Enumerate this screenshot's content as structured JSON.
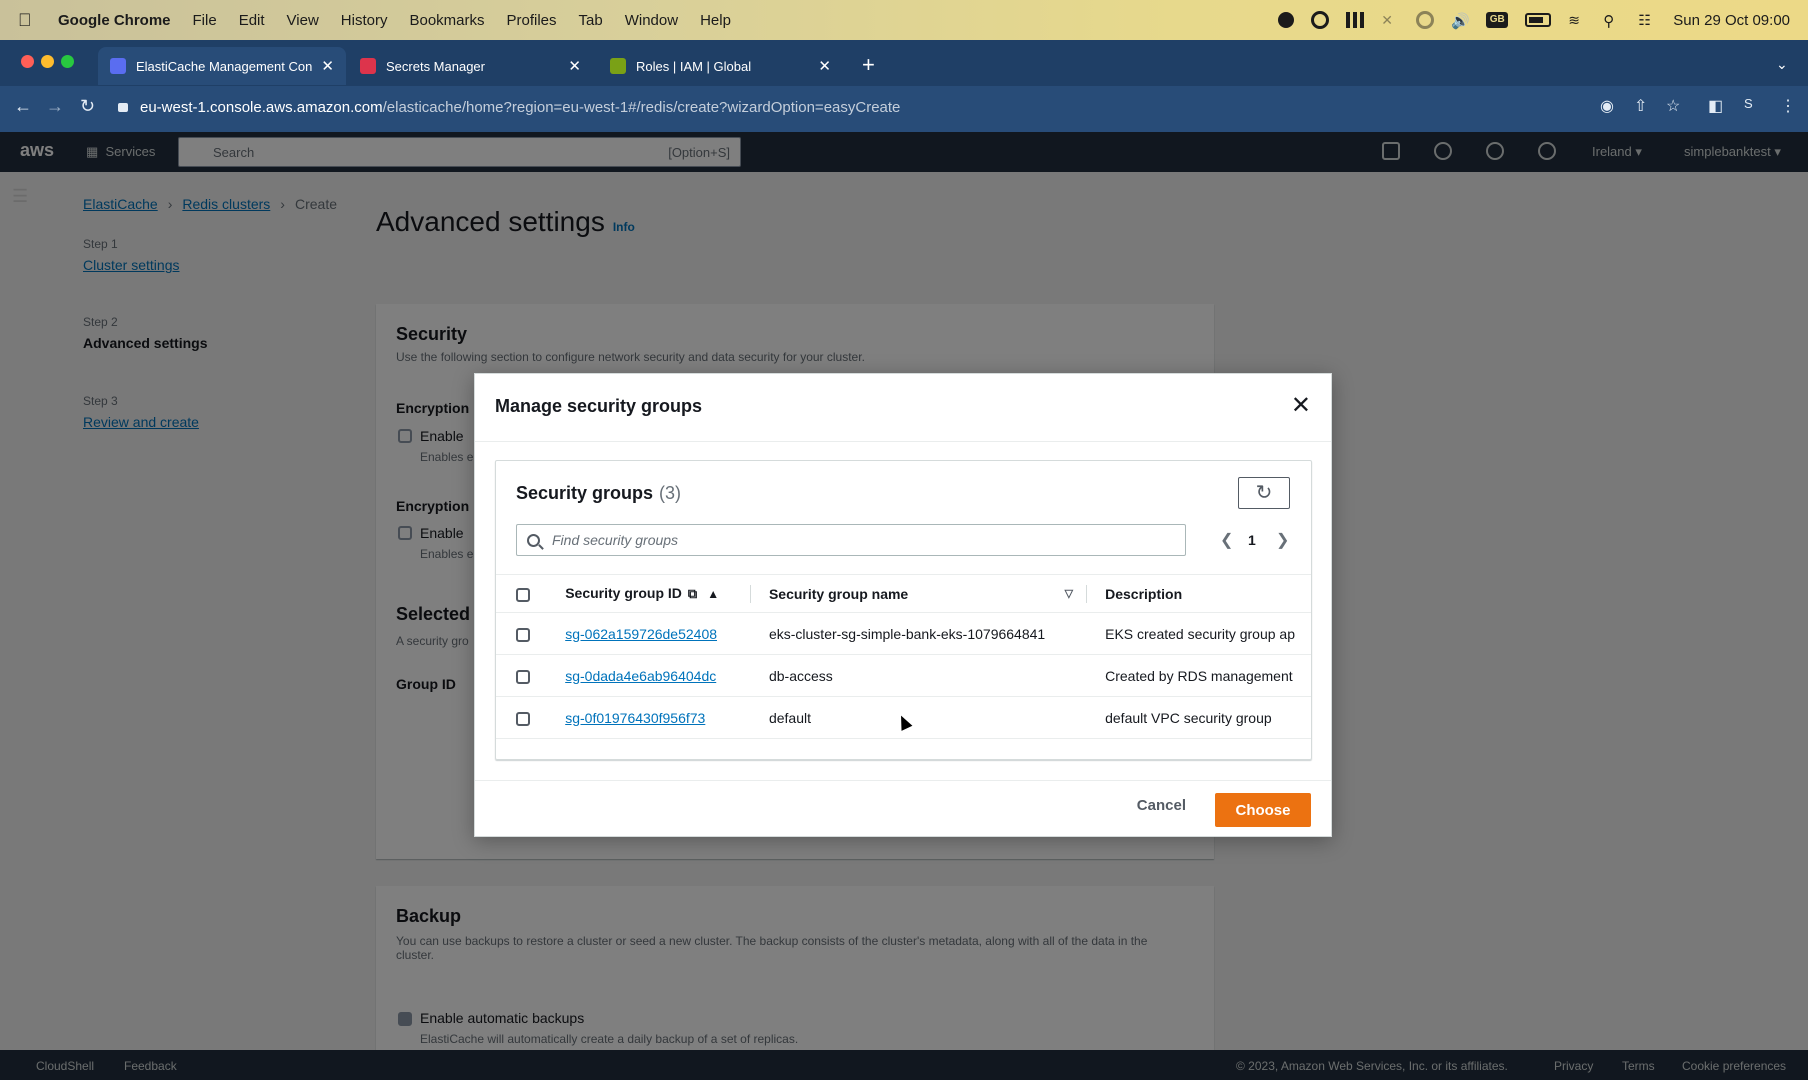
{
  "menubar": {
    "app_name": "Google Chrome",
    "items": [
      "File",
      "Edit",
      "View",
      "History",
      "Bookmarks",
      "Profiles",
      "Tab",
      "Window",
      "Help"
    ],
    "status_gb": "GB",
    "datetime": "Sun 29 Oct  09:00"
  },
  "browser": {
    "tabs": [
      {
        "label": "ElastiCache Management Con",
        "favicon_color": "#5a6df0",
        "active": true
      },
      {
        "label": "Secrets Manager",
        "favicon_color": "#dd344c",
        "active": false
      },
      {
        "label": "Roles | IAM | Global",
        "favicon_color": "#7aa116",
        "active": false
      }
    ],
    "url_host": "eu-west-1.console.aws.amazon.com",
    "url_path": "/elasticache/home?region=eu-west-1#/redis/create?wizardOption=easyCreate",
    "profile_initial": "S"
  },
  "aws": {
    "logo": "aws",
    "services": "Services",
    "search_placeholder": "Search",
    "search_shortcut": "[Option+S]",
    "region": "Ireland ▾",
    "account": "simplebanktest ▾",
    "breadcrumb": [
      "ElastiCache",
      "Redis clusters",
      "Create"
    ],
    "steps": [
      {
        "label": "Step 1",
        "name": "Cluster settings"
      },
      {
        "label": "Step 2",
        "name": "Advanced settings"
      },
      {
        "label": "Step 3",
        "name": "Review and create"
      }
    ],
    "page_title": "Advanced settings",
    "info": "Info",
    "security_title": "Security",
    "security_desc": "Use the following section to configure network security and data security for your cluster.",
    "encryption_label": "Encryption",
    "enable_label": "Enable",
    "enables_prefix": "Enables e",
    "selected_label": "Selected",
    "selected_desc": "A security gro",
    "group_id_label": "Group ID",
    "backup_title": "Backup",
    "backup_desc": "You can use backups to restore a cluster or seed a new cluster. The backup consists of the cluster's metadata, along with all of the data in the cluster.",
    "auto_backup_label": "Enable automatic backups",
    "auto_backup_desc": "ElastiCache will automatically create a daily backup of a set of replicas.",
    "footer_cloudshell": "CloudShell",
    "footer_feedback": "Feedback",
    "footer_copyright": "© 2023, Amazon Web Services, Inc. or its affiliates.",
    "footer_privacy": "Privacy",
    "footer_terms": "Terms",
    "footer_cookies": "Cookie preferences"
  },
  "modal": {
    "title": "Manage security groups",
    "container_title": "Security groups",
    "count": "(3)",
    "search_placeholder": "Find security groups",
    "page_number": "1",
    "columns": {
      "id": "Security group ID",
      "name": "Security group name",
      "description": "Description"
    },
    "rows": [
      {
        "id": "sg-062a159726de52408",
        "name": "eks-cluster-sg-simple-bank-eks-1079664841",
        "description": "EKS created security group ap"
      },
      {
        "id": "sg-0dada4e6ab96404dc",
        "name": "db-access",
        "description": "Created by RDS management"
      },
      {
        "id": "sg-0f01976430f956f73",
        "name": "default",
        "description": "default VPC security group"
      }
    ],
    "cancel_label": "Cancel",
    "choose_label": "Choose"
  },
  "colors": {
    "accent_orange": "#ec7211",
    "link_blue": "#0073bb",
    "chrome_tab_bg": "#1f3f66"
  }
}
